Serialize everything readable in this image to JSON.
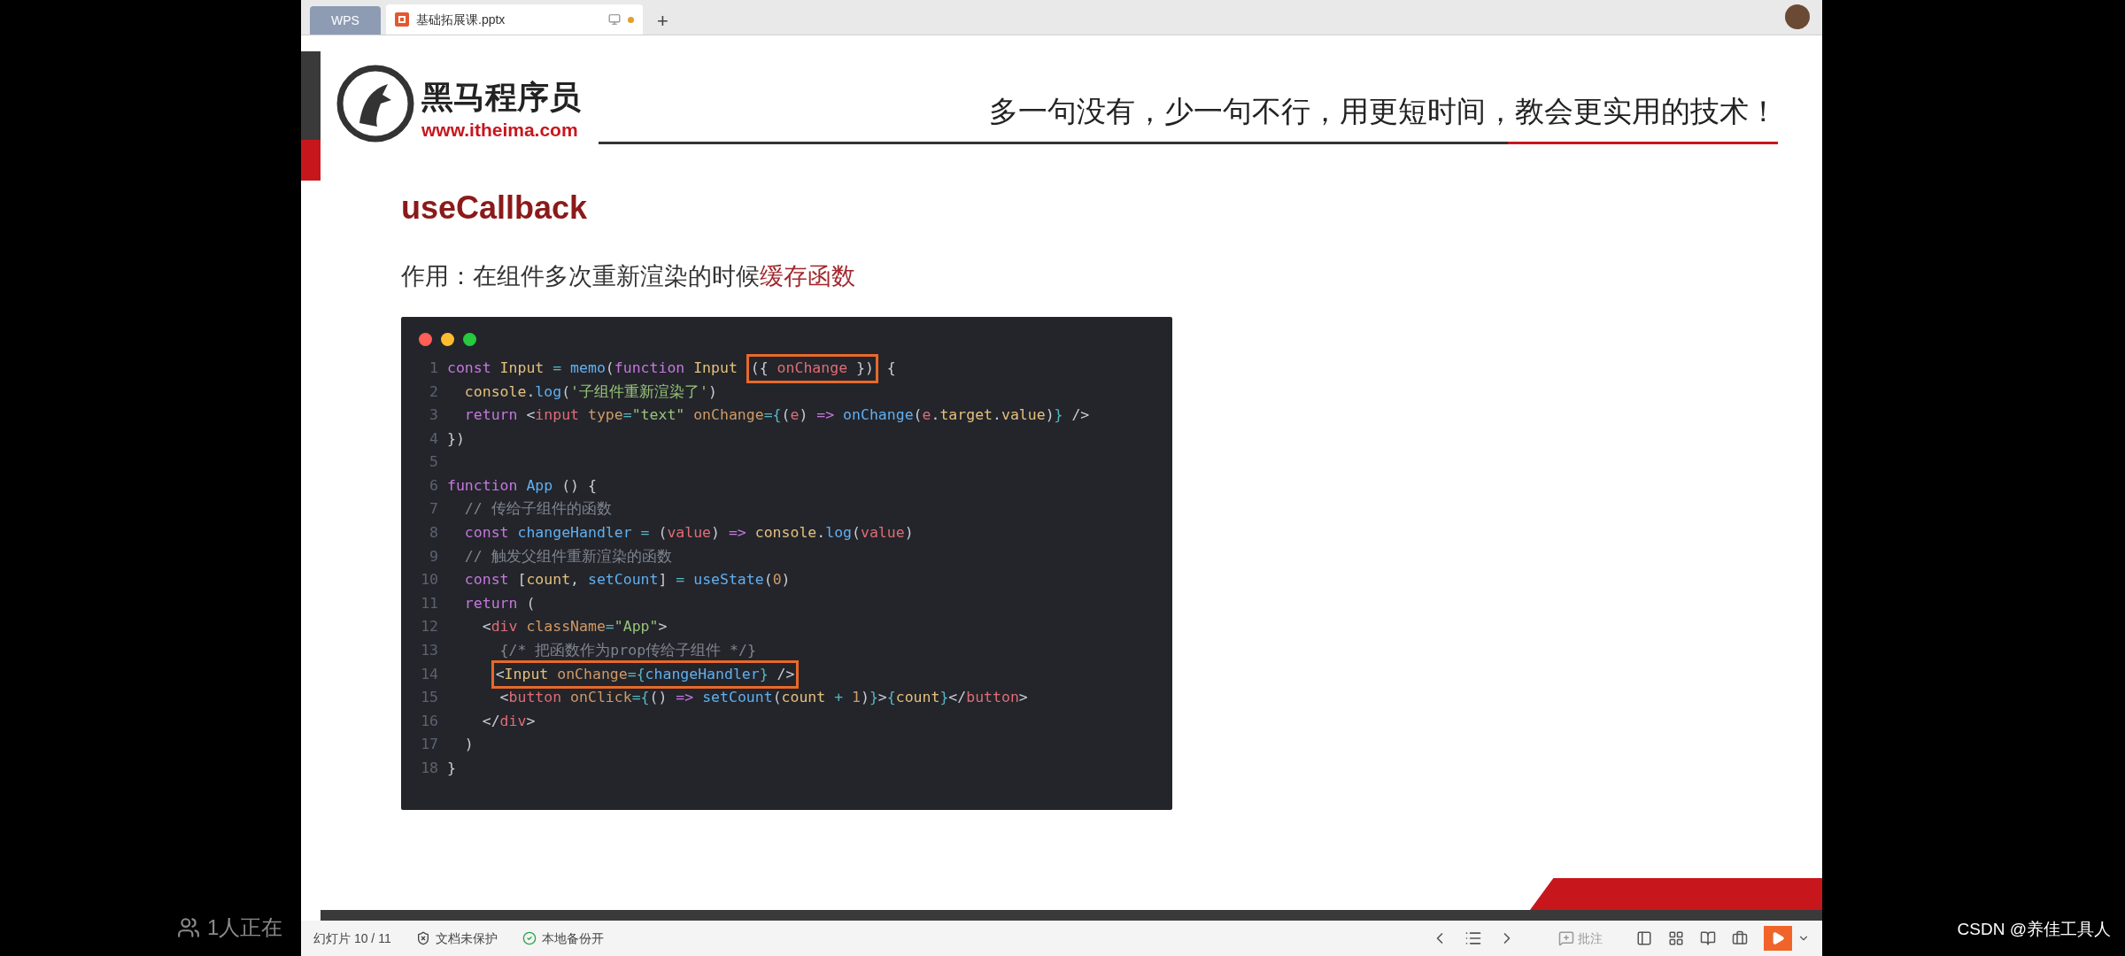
{
  "browser_tabs": [
    {
      "label": "WPS",
      "selected": false
    },
    {
      "label": "基础拓展课.pptx",
      "selected": true
    }
  ],
  "new_tab": "+",
  "slide": {
    "brand_name": "黑马程序员",
    "brand_url": "www.itheima.com",
    "slogan": "多一句没有，少一句不行，用更短时间，教会更实用的技术！",
    "title": "useCallback",
    "subtitle": [
      {
        "text": "作用：在组件多次重新渲染的时候",
        "emphasis": false
      },
      {
        "text": "缓存函数",
        "emphasis": true
      }
    ],
    "code_lines": [
      {
        "number": "1",
        "segments": [
          {
            "boxed": false,
            "tokens": [
              {
                "kind": "kw",
                "text": "const "
              },
              {
                "kind": "type",
                "text": "Input "
              },
              {
                "kind": "op",
                "text": "= "
              },
              {
                "kind": "fn",
                "text": "memo"
              },
              {
                "kind": "p",
                "text": "("
              },
              {
                "kind": "kw",
                "text": "function "
              },
              {
                "kind": "type",
                "text": "Input "
              }
            ]
          },
          {
            "boxed": true,
            "tokens": [
              {
                "kind": "p",
                "text": "({ "
              },
              {
                "kind": "var",
                "text": "onChange"
              },
              {
                "kind": "p",
                "text": " })"
              }
            ]
          },
          {
            "boxed": false,
            "tokens": [
              {
                "kind": "p",
                "text": " {"
              }
            ]
          }
        ]
      },
      {
        "number": "2",
        "segments": [
          {
            "boxed": false,
            "tokens": [
              {
                "kind": "type",
                "text": "  console"
              },
              {
                "kind": "p",
                "text": "."
              },
              {
                "kind": "fn",
                "text": "log"
              },
              {
                "kind": "p",
                "text": "("
              },
              {
                "kind": "str",
                "text": "'子组件重新渲染了'"
              },
              {
                "kind": "p",
                "text": ")"
              }
            ]
          }
        ]
      },
      {
        "number": "3",
        "segments": [
          {
            "boxed": false,
            "tokens": [
              {
                "kind": "kw",
                "text": "  return "
              },
              {
                "kind": "p",
                "text": "<"
              },
              {
                "kind": "tag",
                "text": "input "
              },
              {
                "kind": "attr",
                "text": "type"
              },
              {
                "kind": "op",
                "text": "="
              },
              {
                "kind": "str",
                "text": "\"text\" "
              },
              {
                "kind": "attr",
                "text": "onChange"
              },
              {
                "kind": "op",
                "text": "={"
              },
              {
                "kind": "p",
                "text": "("
              },
              {
                "kind": "var",
                "text": "e"
              },
              {
                "kind": "p",
                "text": ") "
              },
              {
                "kind": "kw",
                "text": "=> "
              },
              {
                "kind": "fn",
                "text": "onChange"
              },
              {
                "kind": "p",
                "text": "("
              },
              {
                "kind": "var",
                "text": "e"
              },
              {
                "kind": "p",
                "text": "."
              },
              {
                "kind": "prop",
                "text": "target"
              },
              {
                "kind": "p",
                "text": "."
              },
              {
                "kind": "prop",
                "text": "value"
              },
              {
                "kind": "p",
                "text": ")"
              },
              {
                "kind": "op",
                "text": "}"
              },
              {
                "kind": "p",
                "text": " />"
              }
            ]
          }
        ]
      },
      {
        "number": "4",
        "segments": [
          {
            "boxed": false,
            "tokens": [
              {
                "kind": "p",
                "text": "})"
              }
            ]
          }
        ]
      },
      {
        "number": "5"
      },
      {
        "number": "6",
        "segments": [
          {
            "boxed": false,
            "tokens": [
              {
                "kind": "kw",
                "text": "function "
              },
              {
                "kind": "fn",
                "text": "App "
              },
              {
                "kind": "p",
                "text": "() {"
              }
            ]
          }
        ]
      },
      {
        "number": "7",
        "segments": [
          {
            "boxed": false,
            "tokens": [
              {
                "kind": "cm",
                "text": "  // 传给子组件的函数"
              }
            ]
          }
        ]
      },
      {
        "number": "8",
        "segments": [
          {
            "boxed": false,
            "tokens": [
              {
                "kind": "kw",
                "text": "  const "
              },
              {
                "kind": "fn",
                "text": "changeHandler "
              },
              {
                "kind": "op",
                "text": "= "
              },
              {
                "kind": "p",
                "text": "("
              },
              {
                "kind": "var",
                "text": "value"
              },
              {
                "kind": "p",
                "text": ") "
              },
              {
                "kind": "kw",
                "text": "=> "
              },
              {
                "kind": "type",
                "text": "console"
              },
              {
                "kind": "p",
                "text": "."
              },
              {
                "kind": "fn",
                "text": "log"
              },
              {
                "kind": "p",
                "text": "("
              },
              {
                "kind": "var",
                "text": "value"
              },
              {
                "kind": "p",
                "text": ")"
              }
            ]
          }
        ]
      },
      {
        "number": "9",
        "segments": [
          {
            "boxed": false,
            "tokens": [
              {
                "kind": "cm",
                "text": "  // 触发父组件重新渲染的函数"
              }
            ]
          }
        ]
      },
      {
        "number": "10",
        "segments": [
          {
            "boxed": false,
            "tokens": [
              {
                "kind": "kw",
                "text": "  const "
              },
              {
                "kind": "p",
                "text": "["
              },
              {
                "kind": "type",
                "text": "count"
              },
              {
                "kind": "p",
                "text": ", "
              },
              {
                "kind": "fn",
                "text": "setCount"
              },
              {
                "kind": "p",
                "text": "] "
              },
              {
                "kind": "op",
                "text": "= "
              },
              {
                "kind": "fn",
                "text": "useState"
              },
              {
                "kind": "p",
                "text": "("
              },
              {
                "kind": "num",
                "text": "0"
              },
              {
                "kind": "p",
                "text": ")"
              }
            ]
          }
        ]
      },
      {
        "number": "11",
        "segments": [
          {
            "boxed": false,
            "tokens": [
              {
                "kind": "kw",
                "text": "  return "
              },
              {
                "kind": "p",
                "text": "("
              }
            ]
          }
        ]
      },
      {
        "number": "12",
        "segments": [
          {
            "boxed": false,
            "tokens": [
              {
                "kind": "p",
                "text": "    <"
              },
              {
                "kind": "tag",
                "text": "div "
              },
              {
                "kind": "attr",
                "text": "className"
              },
              {
                "kind": "op",
                "text": "="
              },
              {
                "kind": "str",
                "text": "\"App\""
              },
              {
                "kind": "p",
                "text": ">"
              }
            ]
          }
        ]
      },
      {
        "number": "13",
        "segments": [
          {
            "boxed": false,
            "tokens": [
              {
                "kind": "cm",
                "text": "      {/* 把函数作为prop传给子组件 */}"
              }
            ]
          }
        ]
      },
      {
        "number": "14",
        "segments": [
          {
            "boxed": true,
            "tokens": [
              {
                "kind": "p",
                "text": "     <"
              },
              {
                "kind": "type",
                "text": "Input "
              },
              {
                "kind": "attr",
                "text": "onChange"
              },
              {
                "kind": "op",
                "text": "={"
              },
              {
                "kind": "fn",
                "text": "changeHandler"
              },
              {
                "kind": "op",
                "text": "}"
              },
              {
                "kind": "p",
                "text": " />"
              }
            ]
          }
        ]
      },
      {
        "number": "15",
        "segments": [
          {
            "boxed": false,
            "tokens": [
              {
                "kind": "p",
                "text": "      <"
              },
              {
                "kind": "tag",
                "text": "button "
              },
              {
                "kind": "attr",
                "text": "onClick"
              },
              {
                "kind": "op",
                "text": "={"
              },
              {
                "kind": "p",
                "text": "() "
              },
              {
                "kind": "kw",
                "text": "=> "
              },
              {
                "kind": "fn",
                "text": "setCount"
              },
              {
                "kind": "p",
                "text": "("
              },
              {
                "kind": "type",
                "text": "count "
              },
              {
                "kind": "op",
                "text": "+ "
              },
              {
                "kind": "num",
                "text": "1"
              },
              {
                "kind": "p",
                "text": ")"
              },
              {
                "kind": "op",
                "text": "}"
              },
              {
                "kind": "p",
                "text": ">"
              },
              {
                "kind": "op",
                "text": "{"
              },
              {
                "kind": "type",
                "text": "count"
              },
              {
                "kind": "op",
                "text": "}"
              },
              {
                "kind": "p",
                "text": "</"
              },
              {
                "kind": "tag",
                "text": "button"
              },
              {
                "kind": "p",
                "text": ">"
              }
            ]
          }
        ]
      },
      {
        "number": "16",
        "segments": [
          {
            "boxed": false,
            "tokens": [
              {
                "kind": "p",
                "text": "    </"
              },
              {
                "kind": "tag",
                "text": "div"
              },
              {
                "kind": "p",
                "text": ">"
              }
            ]
          }
        ]
      },
      {
        "number": "17",
        "segments": [
          {
            "boxed": false,
            "tokens": [
              {
                "kind": "p",
                "text": "  )"
              }
            ]
          }
        ]
      },
      {
        "number": "18",
        "segments": [
          {
            "boxed": false,
            "tokens": [
              {
                "kind": "p",
                "text": "}"
              }
            ]
          }
        ]
      }
    ]
  },
  "status_bar": {
    "slide_counter": "幻灯片 10 / 11",
    "protection": "文档未保护",
    "backup": "本地备份开",
    "comment": "批注"
  },
  "overlay": {
    "viewers": "1人正在",
    "credit": "CSDN @养佳工具人"
  }
}
